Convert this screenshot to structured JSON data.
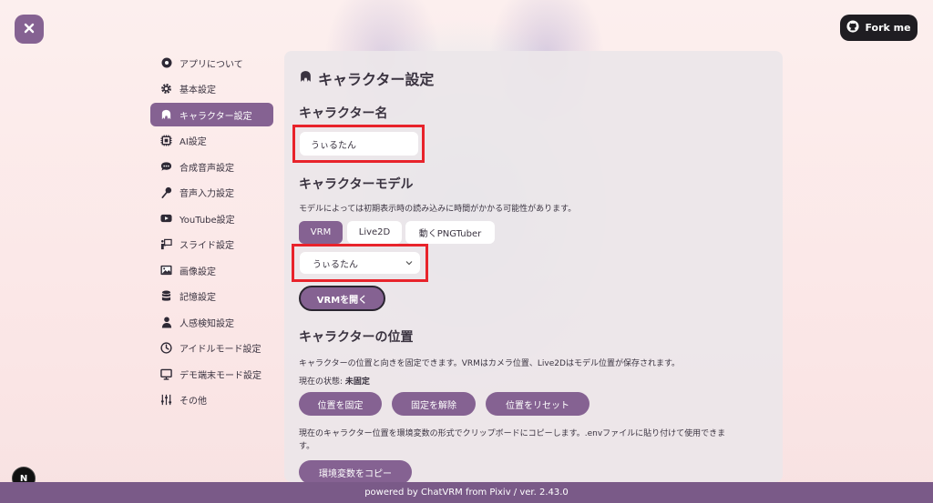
{
  "header": {
    "close_icon": "close-icon",
    "fork_label": "Fork me",
    "fork_icon": "github-icon"
  },
  "sidebar": {
    "items": [
      {
        "label": "アプリについて",
        "icon": "info-circle-icon",
        "active": false
      },
      {
        "label": "基本設定",
        "icon": "gear-icon",
        "active": false
      },
      {
        "label": "キャラクター設定",
        "icon": "character-icon",
        "active": true
      },
      {
        "label": "AI設定",
        "icon": "ai-chip-icon",
        "active": false
      },
      {
        "label": "合成音声設定",
        "icon": "speech-bubble-icon",
        "active": false
      },
      {
        "label": "音声入力設定",
        "icon": "microphone-icon",
        "active": false
      },
      {
        "label": "YouTube設定",
        "icon": "youtube-icon",
        "active": false
      },
      {
        "label": "スライド設定",
        "icon": "presentation-icon",
        "active": false
      },
      {
        "label": "画像設定",
        "icon": "image-icon",
        "active": false
      },
      {
        "label": "記憶設定",
        "icon": "database-icon",
        "active": false
      },
      {
        "label": "人感検知設定",
        "icon": "person-icon",
        "active": false
      },
      {
        "label": "アイドルモード設定",
        "icon": "clock-icon",
        "active": false
      },
      {
        "label": "デモ端末モード設定",
        "icon": "monitor-icon",
        "active": false
      },
      {
        "label": "その他",
        "icon": "sliders-icon",
        "active": false
      }
    ]
  },
  "main": {
    "title": "キャラクター設定",
    "character_name": {
      "heading": "キャラクター名",
      "value": "うぃるたん"
    },
    "model": {
      "heading": "キャラクターモデル",
      "description": "モデルによっては初期表示時の読み込みに時間がかかる可能性があります。",
      "tabs": [
        "VRM",
        "Live2D",
        "動くPNGTuber"
      ],
      "active_tab": "VRM",
      "selected": "うぃるたん",
      "open_button": "VRMを開く"
    },
    "position": {
      "heading": "キャラクターの位置",
      "description": "キャラクターの位置と向きを固定できます。VRMはカメラ位置、Live2Dはモデル位置が保存されます。",
      "status_label": "現在の状態:",
      "status_value": "未固定",
      "buttons": [
        "位置を固定",
        "固定を解除",
        "位置をリセット"
      ],
      "copy_description": "現在のキャラクター位置を環境変数の形式でクリップボードにコピーします。.envファイルに貼り付けて使用できます。",
      "copy_button": "環境変数をコピー"
    }
  },
  "footer": {
    "text": "powered by ChatVRM from Pixiv / ver. 2.43.0"
  },
  "badge": {
    "letter": "N"
  },
  "colors": {
    "accent": "#856292",
    "highlight": "#e8232b",
    "footer": "#7a5a88"
  }
}
